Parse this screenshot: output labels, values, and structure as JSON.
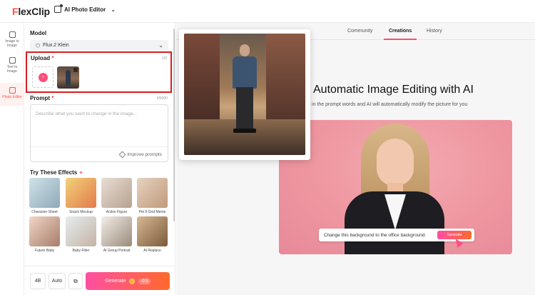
{
  "app": {
    "logo_initial": "F",
    "logo_rest": "lexClip",
    "tool_name": "AI Photo Editor"
  },
  "rail": {
    "items": [
      {
        "label_1": "Image to",
        "label_2": "Image"
      },
      {
        "label_1": "Text to",
        "label_2": "Image"
      },
      {
        "label_1": "Photo Editor",
        "label_2": ""
      }
    ]
  },
  "panel": {
    "model_label": "Model",
    "model_value": "Flux.2 Klein",
    "upload_label": "Upload",
    "upload_count": "1/5",
    "prompt_label": "Prompt",
    "prompt_count": "0/5000",
    "prompt_placeholder": "Describe what you want to change in the image...",
    "improve_label": "Improve prompts",
    "effects_label": "Try These Effects",
    "effects": [
      {
        "name": "Character Sheet"
      },
      {
        "name": "Snack Mockup"
      },
      {
        "name": "Action Figure"
      },
      {
        "name": "Pet 9 Grid Meme"
      },
      {
        "name": "Future Baby"
      },
      {
        "name": "Baby Filter"
      },
      {
        "name": "AI Group Portrait"
      },
      {
        "name": "AI Replace"
      }
    ],
    "count_chip": "4B",
    "mode_chip": "Auto",
    "generate_label": "Generate",
    "generate_cost": "-0.5"
  },
  "main": {
    "tabs": [
      {
        "label": "Community"
      },
      {
        "label": "Creations"
      },
      {
        "label": "History"
      }
    ],
    "active_tab": "Creations",
    "hero_title": "Automatic Image Editing with AI",
    "hero_subtitle": "ll in the prompt words and AI will automatically modify the picture for you",
    "demo_prompt": "Change this background to the office background.",
    "demo_generate": "Generate"
  },
  "colors": {
    "accent": "#ff4f6a",
    "highlight_border": "#d61d1d",
    "gradient_start": "#ff4fa3",
    "gradient_end": "#ff6a2c"
  }
}
